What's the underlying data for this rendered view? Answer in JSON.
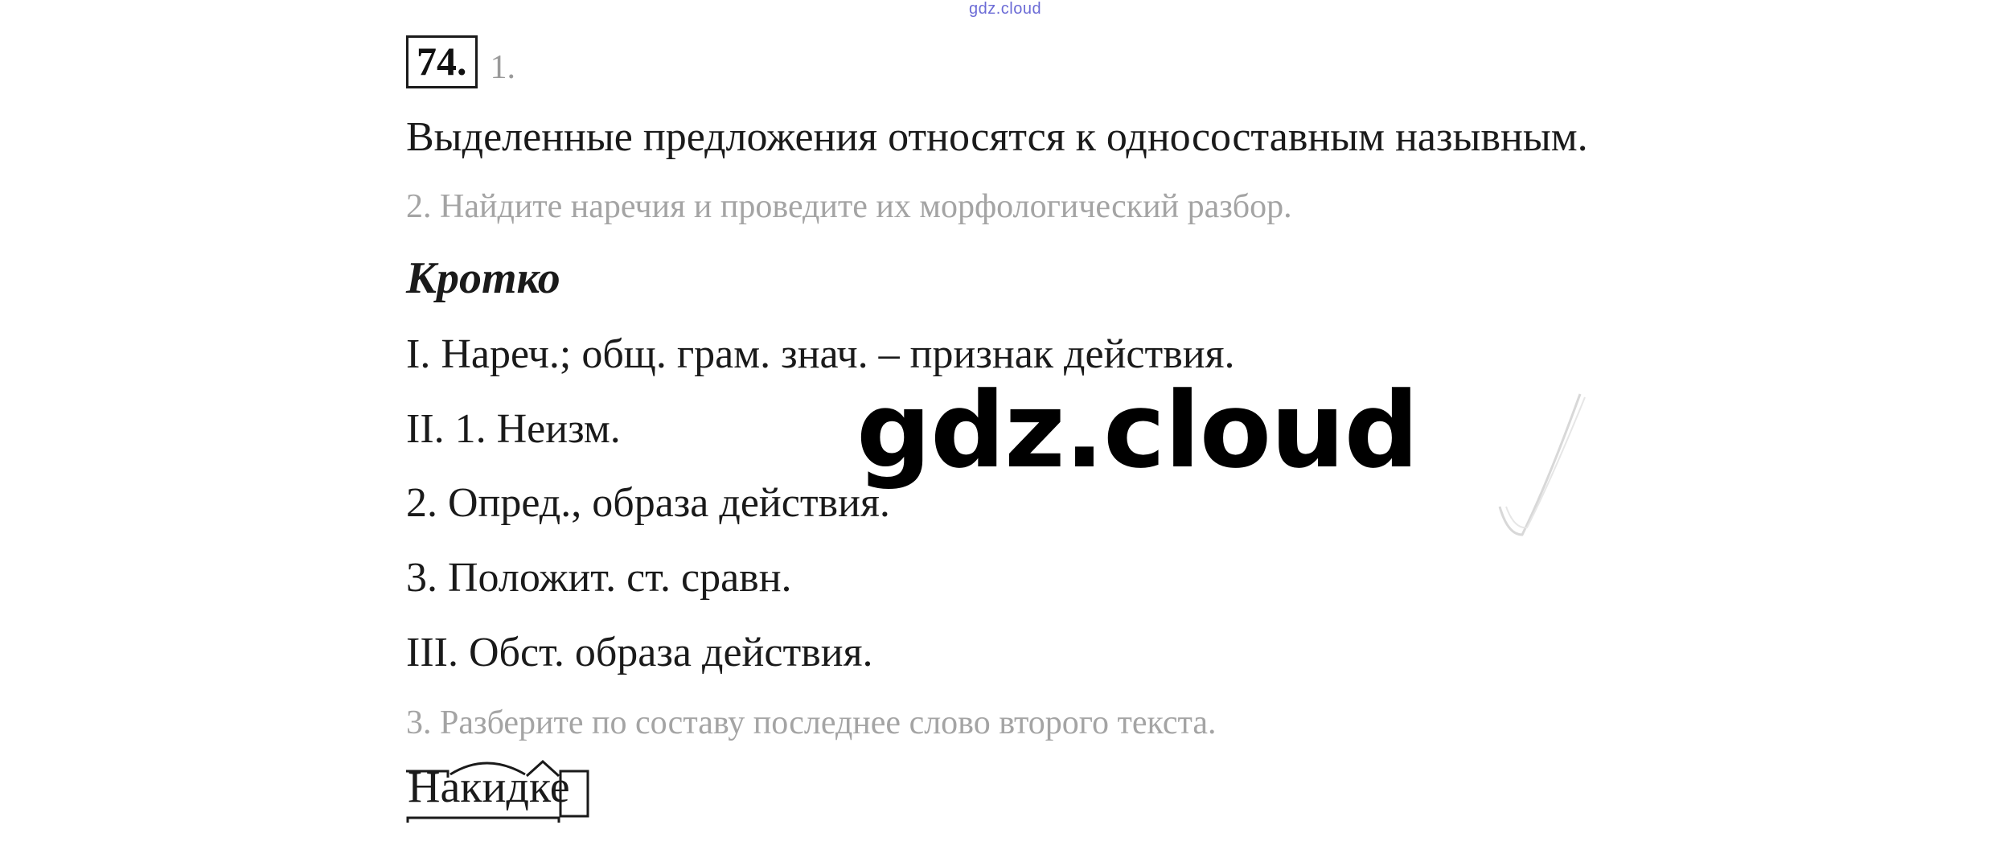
{
  "watermark_top": "gdz.cloud",
  "watermark_center": "gdz.cloud",
  "task": {
    "number": "74.",
    "sub_index": "1."
  },
  "lines": {
    "answer_1": "Выделенные предложения относятся к односоставным назывным.",
    "question_2": "2. Найдите наречия и проведите их морфологический разбор.",
    "word_heading": "Кротко",
    "parse_1": "I. Нареч.; общ. грам. знач. – признак действия.",
    "parse_2": "II. 1. Неизм.",
    "parse_3": "2. Опред., образа действия.",
    "parse_4": "3. Положит. ст. сравн.",
    "parse_5": "III. Обст. образа действия.",
    "question_3": "3. Разберите по составу последнее слово второго текста."
  },
  "morpheme_word": "Накидке"
}
